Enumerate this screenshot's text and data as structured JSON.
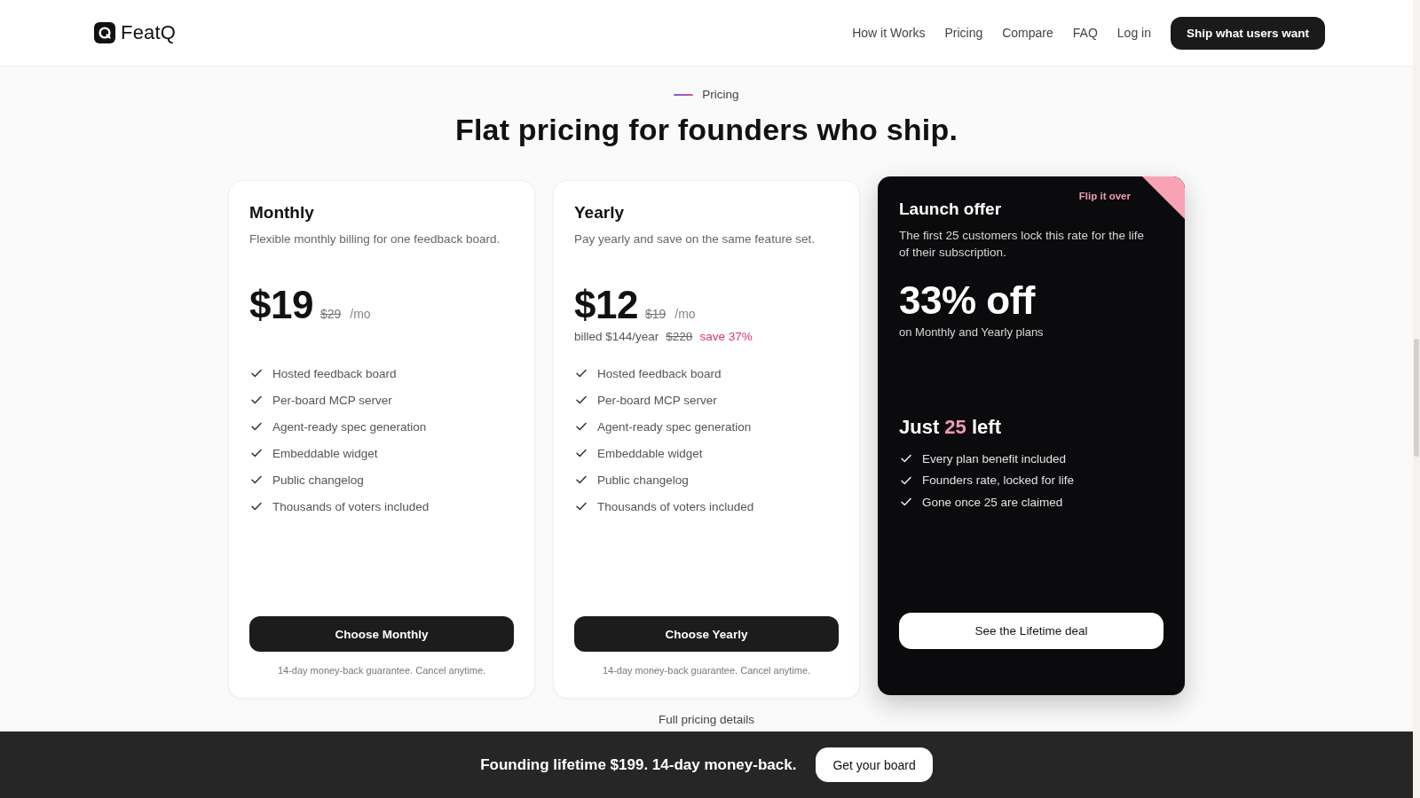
{
  "header": {
    "logo": "FeatQ",
    "nav": [
      "How it Works",
      "Pricing",
      "Compare",
      "FAQ",
      "Log in"
    ],
    "cta": "Ship what users want"
  },
  "section": {
    "eyebrow": "Pricing",
    "title": "Flat pricing for founders who ship."
  },
  "plans": [
    {
      "name": "Monthly",
      "description": "Flexible monthly billing for one feedback board.",
      "price": "$19",
      "old_price": "$29",
      "period": "/mo",
      "features": [
        "Hosted feedback board",
        "Per-board MCP server",
        "Agent-ready spec generation",
        "Embeddable widget",
        "Public changelog",
        "Thousands of voters included"
      ],
      "button": "Choose Monthly",
      "note": "14-day money-back guarantee. Cancel anytime."
    },
    {
      "name": "Yearly",
      "description": "Pay yearly and save on the same feature set.",
      "price": "$12",
      "old_price": "$19",
      "period": "/mo",
      "billing": {
        "text": "billed $144/year",
        "old": "$228",
        "save": "save 37%"
      },
      "features": [
        "Hosted feedback board",
        "Per-board MCP server",
        "Agent-ready spec generation",
        "Embeddable widget",
        "Public changelog",
        "Thousands of voters included"
      ],
      "button": "Choose Yearly",
      "note": "14-day money-back guarantee. Cancel anytime."
    }
  ],
  "launch_offer": {
    "flip_link": "Flip it over",
    "title": "Launch offer",
    "description": "The first 25 customers lock this rate for the life of their subscription.",
    "discount": "33% off",
    "discount_note": "on Monthly and Yearly plans",
    "remaining": {
      "before": "Just",
      "count": "25",
      "after": "left"
    },
    "features": [
      "Every plan benefit included",
      "Founders rate, locked for life",
      "Gone once 25 are claimed"
    ],
    "button": "See the Lifetime deal"
  },
  "details_link": "Full pricing details",
  "banner": {
    "text": "Founding lifetime $199. 14-day money-back.",
    "button": "Get your board"
  }
}
